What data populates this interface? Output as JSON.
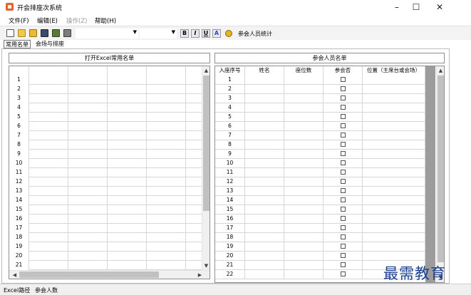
{
  "window": {
    "title": "开会排座次系统",
    "controls": {
      "minimize": "–",
      "maximize": "☐",
      "close": "✕"
    }
  },
  "menu": [
    {
      "label": "文件(F)",
      "enabled": true
    },
    {
      "label": "编辑(E)",
      "enabled": true
    },
    {
      "label": "操作(Z)",
      "enabled": false
    },
    {
      "label": "帮助(H)",
      "enabled": true
    }
  ],
  "toolbar": {
    "icons": [
      "new-file-icon",
      "open-folder-icon",
      "open-icon",
      "save-icon",
      "import-icon",
      "print-icon"
    ],
    "font_select_value": "",
    "size_select_value": "",
    "format_buttons": [
      {
        "name": "bold",
        "label": "B"
      },
      {
        "name": "italic",
        "label": "I"
      },
      {
        "name": "underline",
        "label": "U"
      },
      {
        "name": "font-color",
        "label": "A"
      }
    ],
    "stats_label": "参会人员统计"
  },
  "tabs": [
    {
      "label": "常用名单",
      "active": true
    },
    {
      "label": "会场与排座",
      "active": false
    }
  ],
  "left_panel": {
    "title_button": "打开Excel常用名单",
    "row_numbers": [
      "1",
      "2",
      "3",
      "4",
      "5",
      "6",
      "7",
      "8",
      "9",
      "10",
      "11",
      "12",
      "13",
      "14",
      "15",
      "16",
      "17",
      "18",
      "19",
      "20",
      "21"
    ]
  },
  "right_panel": {
    "title": "参会人员名单",
    "columns": [
      "入座序号",
      "姓名",
      "座位数",
      "参会否",
      "位置（主席台或会场）"
    ],
    "seat_numbers": [
      "1",
      "2",
      "3",
      "4",
      "5",
      "6",
      "7",
      "8",
      "9",
      "10",
      "11",
      "12",
      "13",
      "14",
      "15",
      "16",
      "17",
      "18",
      "19",
      "20",
      "21",
      "22"
    ]
  },
  "status": {
    "excel_path_label": "Excel路径",
    "attendee_count_label": "参会人数"
  },
  "watermark": "最需教育",
  "colors": {
    "accent": "#e8632b",
    "watermark": "#1c3f8f",
    "scroll_thumb": "#c1c1c1"
  }
}
